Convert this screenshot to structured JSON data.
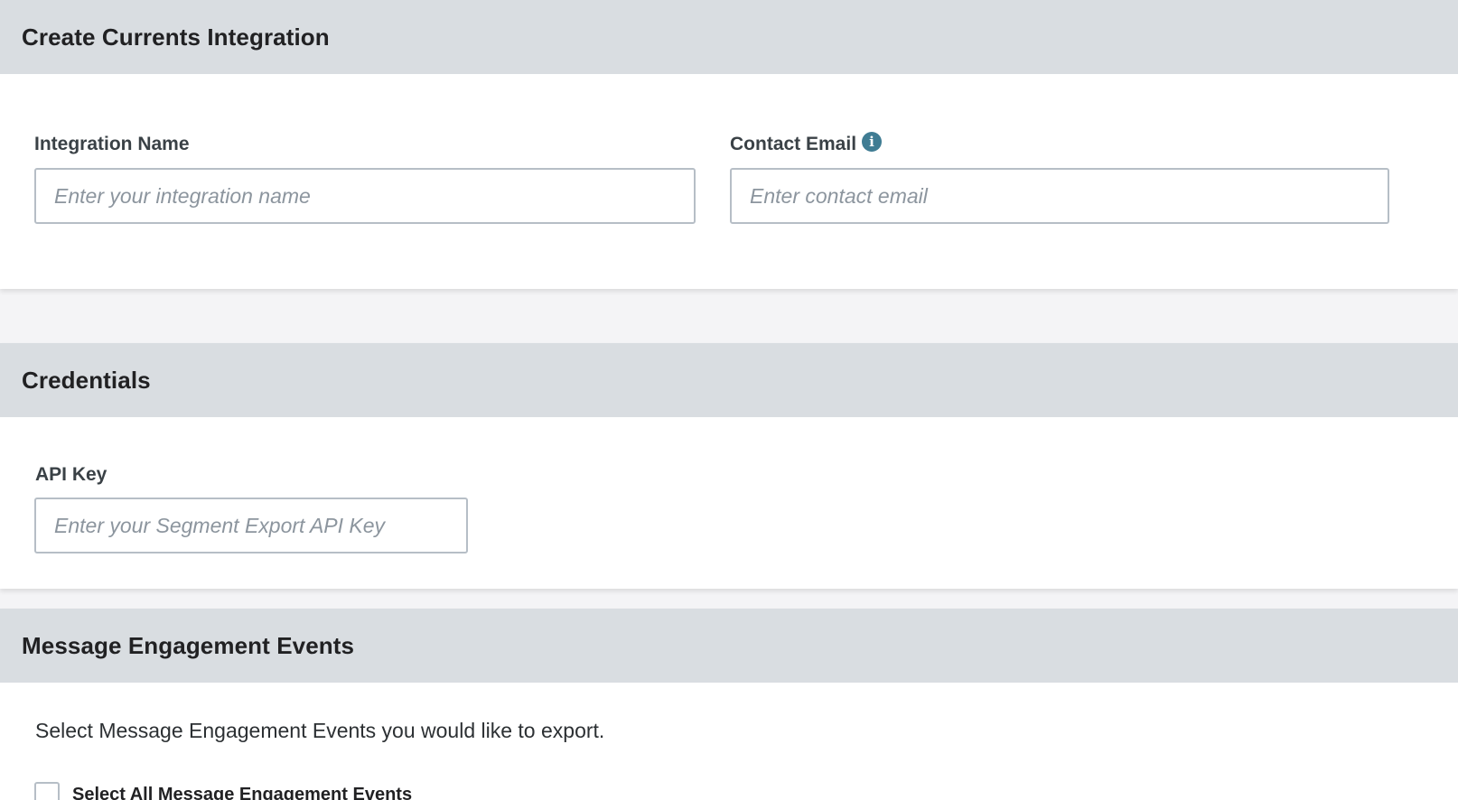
{
  "create_section": {
    "title": "Create Currents Integration",
    "integration_name": {
      "label": "Integration Name",
      "placeholder": "Enter your integration name",
      "value": ""
    },
    "contact_email": {
      "label": "Contact Email",
      "placeholder": "Enter contact email",
      "value": "",
      "info_icon": "info-icon"
    }
  },
  "credentials_section": {
    "title": "Credentials",
    "api_key": {
      "label": "API Key",
      "placeholder": "Enter your Segment Export API Key",
      "value": ""
    }
  },
  "events_section": {
    "title": "Message Engagement Events",
    "description": "Select Message Engagement Events you would like to export.",
    "select_all_label": "Select All Message Engagement Events"
  },
  "colors": {
    "header_bg": "#d9dde1",
    "page_bg": "#f4f4f6",
    "input_border": "#b6bec6",
    "info_icon": "#3f7c93"
  }
}
